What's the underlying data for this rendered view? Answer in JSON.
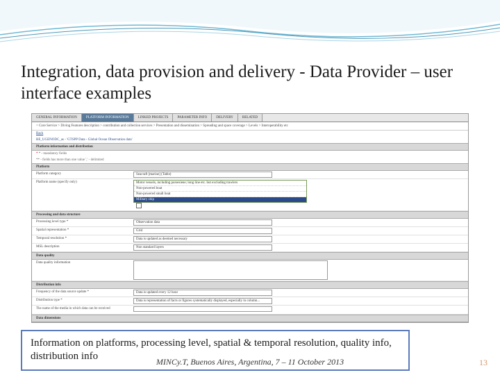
{
  "title": "Integration, data provision and delivery - Data Provider – user interface examples",
  "tabs": [
    {
      "label": "GENERAL INFORMATION"
    },
    {
      "label": "PLATFORM INFORMATION"
    },
    {
      "label": "LINKED PROJECTS"
    },
    {
      "label": "PARAMETER INFO"
    },
    {
      "label": "DELIVERY"
    },
    {
      "label": "RELATED"
    }
  ],
  "breadcrumb": "> Core Service > Diving Features description > contribution and collection services > Presentation and dissemination > Spreading and space coverage > Levels > Interoperability etc",
  "back_link": "Back",
  "code_line": "BE_UGENODC_as - 'GTSPP Data - Global Ocean Observation data'",
  "sections": {
    "platform_hdr": "Platform information and distribution",
    "platform": "Platform",
    "proc_hdr": "Processing and data structure",
    "quality_hdr": "Data quality",
    "dist_hdr": "Distribution info",
    "data_dim_hdr": "Data dimensions"
  },
  "notes": {
    "mandatory": "* - mandatory fields",
    "optional": "** - fields has more than one value ',' - delimited"
  },
  "fields": {
    "platform_category": {
      "label": "Platform category",
      "value": "Seacraft [marine] (Table)"
    },
    "platform_name": {
      "label": "Platform name (specify only)",
      "options": [
        "Motor vessels, including pursesiene; long line etc. but excluding trawlers",
        "Non-powered boat",
        "Non-powered small boat",
        "Military ship"
      ]
    },
    "proc_level": {
      "label": "Processing level type *",
      "value": "Observation data"
    },
    "spatial": {
      "label": "Spatial representation *",
      "value": "Grid"
    },
    "temporal": {
      "label": "Temporal resolution *",
      "value": "Data is updated as deemed necessary"
    },
    "msl": {
      "label": "MSL description",
      "value": "Non standard layers"
    },
    "quality": {
      "label": "Data quality information"
    },
    "frequency": {
      "label": "Frequency of the data source update *",
      "value": "Data is updated every 12 hour"
    },
    "dist_type": {
      "label": "Distribution type *",
      "value": "Data is representation of facts or figures systematically displayed, especially in column..."
    },
    "media": {
      "label": "The name of the media in which data can be received"
    }
  },
  "caption": "Information on platforms, processing level, spatial & temporal resolution, quality info, distribution info",
  "footer": "MINCy.T, Buenos Aires, Argentina, 7 – 11 October 2013",
  "page": "13"
}
